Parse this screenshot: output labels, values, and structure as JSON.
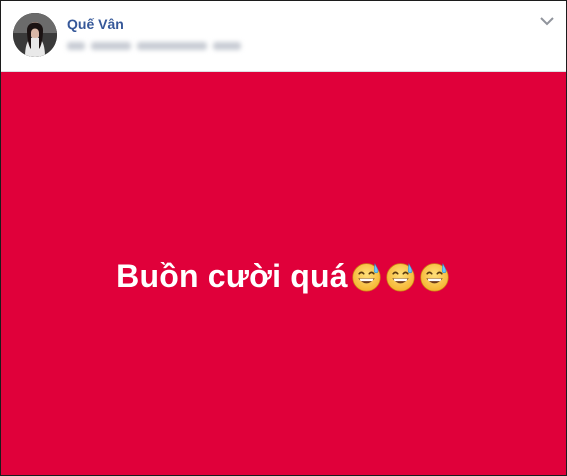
{
  "post": {
    "author_name": "Quế Vân",
    "background_color": "#e0003a",
    "text_color": "#ffffff",
    "status_text": "Buồn cười quá",
    "emojis": [
      "grinning-sweat-emoji",
      "grinning-sweat-emoji",
      "grinning-sweat-emoji"
    ]
  },
  "colors": {
    "author_link": "#365899",
    "border": "#1c1c1c"
  }
}
